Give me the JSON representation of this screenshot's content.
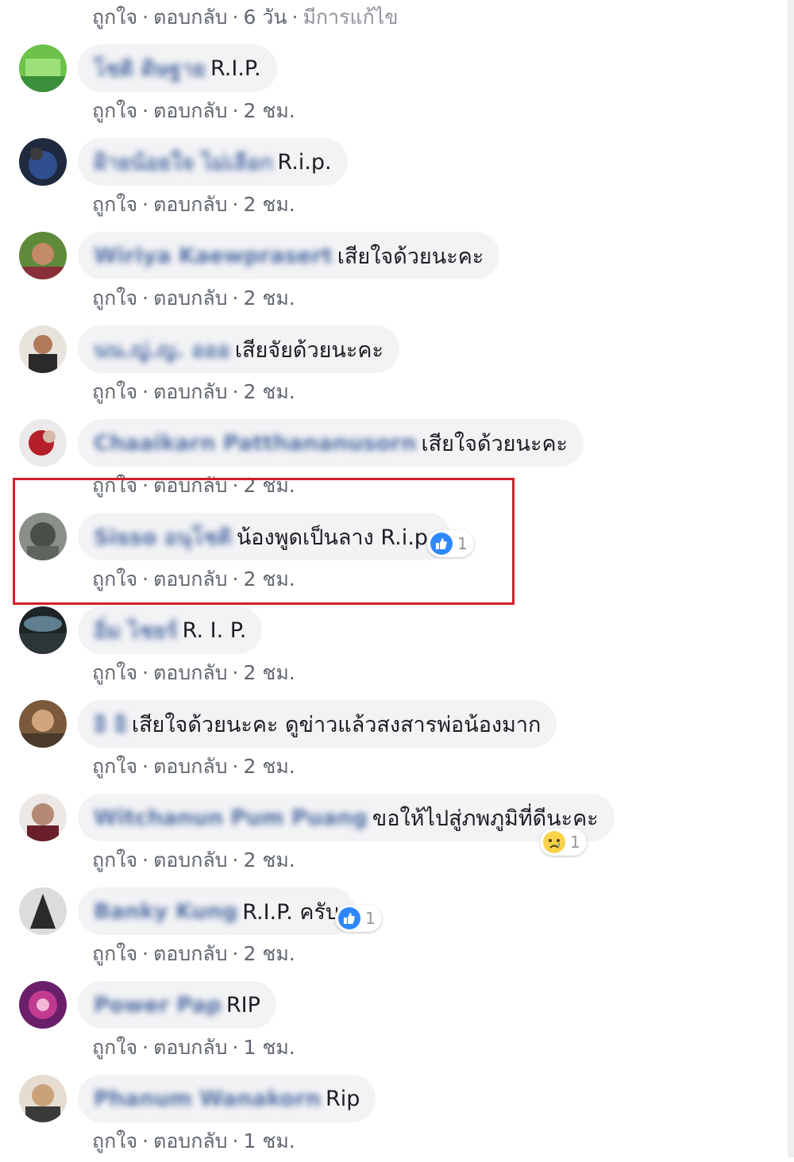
{
  "colors": {
    "bubble": "#f2f3f5",
    "link": "#385898",
    "meta": "#616770",
    "highlight": "#d31f2a",
    "like": "#2d88ff",
    "sad": "#f7d24a"
  },
  "top": {
    "like_label": "ถูกใจ",
    "reply_label": "ตอบกลับ",
    "time": "6 วัน",
    "edited": "มีการแก้ไข"
  },
  "comments": [
    {
      "author": "โชติ ดิษฐาย",
      "text": "R.I.P.",
      "like_label": "ถูกใจ",
      "reply_label": "ตอบกลับ",
      "time": "2 ชม."
    },
    {
      "author": "ฝ้ายน้อยใจ ไม่เลือก",
      "text": "R.i.p.",
      "like_label": "ถูกใจ",
      "reply_label": "ตอบกลับ",
      "time": "2 ชม."
    },
    {
      "author": "Wiriya Kaewprasert",
      "text": "เสียใจด้วยนะคะ",
      "like_label": "ถูกใจ",
      "reply_label": "ตอบกลับ",
      "time": "2 ชม."
    },
    {
      "author": "นน.ญ่.ญ.  อออ",
      "text": "เสียจัยด้วยนะคะ",
      "like_label": "ถูกใจ",
      "reply_label": "ตอบกลับ",
      "time": "2 ชม."
    },
    {
      "author": "Chaaikarn Patthananusorn",
      "text": "เสียใจด้วยนะคะ",
      "like_label": "ถูกใจ",
      "reply_label": "ตอบกลับ",
      "time": "2 ชม."
    },
    {
      "author": "Sisso อนุโชติ",
      "text": "น้องพูดเป็นลาง R.i.p.",
      "like_label": "ถูกใจ",
      "reply_label": "ตอบกลับ",
      "time": "2 ชม.",
      "reaction": {
        "icon": "like-icon",
        "count": "1"
      }
    },
    {
      "author": "อิ่ม ไชยร์",
      "text": "R. I. P.",
      "like_label": "ถูกใจ",
      "reply_label": "ตอบกลับ",
      "time": "2 ชม."
    },
    {
      "author": "อิ อิ",
      "text": "เสียใจด้วยนะคะ ดูข่าวแล้วสงสารพ่อน้องมาก",
      "like_label": "ถูกใจ",
      "reply_label": "ตอบกลับ",
      "time": "2 ชม."
    },
    {
      "author": "Witchanun Pum Puang",
      "text": "ขอให้ไปสู่ภพภูมิที่ดีนะคะ",
      "like_label": "ถูกใจ",
      "reply_label": "ตอบกลับ",
      "time": "2 ชม.",
      "reaction": {
        "icon": "sad-icon",
        "count": "1"
      }
    },
    {
      "author": "Banky Kung",
      "text": "R.I.P. ครับ",
      "like_label": "ถูกใจ",
      "reply_label": "ตอบกลับ",
      "time": "2 ชม.",
      "reaction": {
        "icon": "like-icon",
        "count": "1"
      }
    },
    {
      "author": "Power Pap",
      "text": "RIP",
      "like_label": "ถูกใจ",
      "reply_label": "ตอบกลับ",
      "time": "1 ชม."
    },
    {
      "author": "Phanum Wanakorn",
      "text": "Rip",
      "like_label": "ถูกใจ",
      "reply_label": "ตอบกลับ",
      "time": "1 ชม."
    }
  ]
}
